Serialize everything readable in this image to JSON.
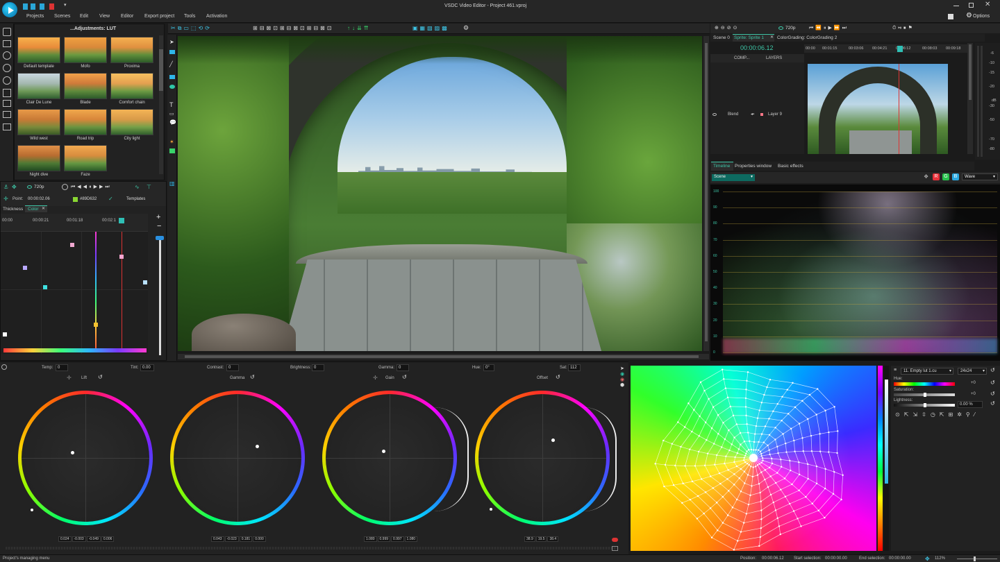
{
  "app": {
    "title": "VSDC Video Editor - Project 461.vproj",
    "options_label": "Options",
    "menu": [
      "Projects",
      "Scenes",
      "Edit",
      "View",
      "Editor",
      "Export project",
      "Tools",
      "Activation"
    ]
  },
  "lut_panel": {
    "title": "...Adjustments: LUT",
    "templates": [
      "Default template",
      "Mofo",
      "Proxima",
      "Clair De Lune",
      "Blade",
      "Comfort chain",
      "Wild west",
      "Road trip",
      "City light",
      "Night dive",
      "Faze"
    ]
  },
  "keyframe_panel": {
    "resolution": "720p",
    "point_label": "Point:",
    "point_value": "00:00:02.06",
    "color_value": "#89D632",
    "templates_label": "Templates",
    "tabs": [
      "Thickness",
      "Color"
    ],
    "ruler": [
      "00:00",
      "00:00:21",
      "00:01:18",
      "00:02:1"
    ]
  },
  "timeline_panel": {
    "tabs": [
      "Scene 0",
      "Sprite: Sprite 1",
      "ColorGrading: ColorGrading 2"
    ],
    "time": "00:00:06.12",
    "resolution": "720p",
    "comp_label": "COMP...",
    "layers_label": "LAYERS",
    "blend_label": "Blend",
    "layer_name": "Layer 9",
    "ruler": [
      "00:00",
      "00:01:15",
      "00:03:06",
      "00:04:21",
      "00:06:12",
      "00:08:03",
      "00:09:18"
    ],
    "bottom_tabs": [
      "Timeline",
      "Properties window",
      "Basic effects"
    ]
  },
  "level_meter": {
    "unit": "dB",
    "ticks": [
      "-6",
      "-10",
      "-15",
      "-20",
      "-30",
      "-50",
      "-70",
      "-80"
    ]
  },
  "scope": {
    "source": "Scene",
    "mode": "Wave",
    "channels": [
      "R",
      "G",
      "B"
    ],
    "channel_colors": [
      "#e8313a",
      "#27c24c",
      "#2aa8e0"
    ],
    "y_ticks": [
      "100",
      "90",
      "80",
      "70",
      "60",
      "50",
      "40",
      "30",
      "20",
      "10",
      "0"
    ]
  },
  "color_grading": {
    "params": [
      {
        "label": "Temp:",
        "value": "0"
      },
      {
        "label": "Tint:",
        "value": "0.00"
      },
      {
        "label": "Contrast:",
        "value": "0"
      },
      {
        "label": "Brightness:",
        "value": "0"
      },
      {
        "label": "Gamma:",
        "value": "0"
      },
      {
        "label": "Hue:",
        "value": "0°"
      },
      {
        "label": "Sat:",
        "value": "112"
      }
    ],
    "wheels": [
      {
        "name": "Lift",
        "values": [
          "0.024",
          "-0.003",
          "-0.049",
          "0.006"
        ]
      },
      {
        "name": "Gamma",
        "values": [
          "0.043",
          "-0.023",
          "0.181",
          "0.000"
        ]
      },
      {
        "name": "Gain",
        "values": [
          "1.080",
          "0.999",
          "0.997",
          "1.080"
        ]
      },
      {
        "name": "Offset",
        "values": [
          "38.9",
          "19.5",
          "38.4"
        ]
      }
    ]
  },
  "lut_editor": {
    "lut_name": "11. Empty lut 1.cu",
    "grid_size": "24x24",
    "hue_label": "Hue:",
    "saturation_label": "Saturation:",
    "lightness_label": "Lightness:",
    "hue_value": "+0",
    "saturation_value": "+0",
    "lightness_value": "0.00 %"
  },
  "status_bar": {
    "left": "Project's managing menu",
    "position_label": "Position:",
    "position_value": "00:00:06.12",
    "start_label": "Start selection:",
    "start_value": "00:00:00.00",
    "end_label": "End selection:",
    "end_value": "00:00:00.00",
    "zoom": "112%"
  }
}
